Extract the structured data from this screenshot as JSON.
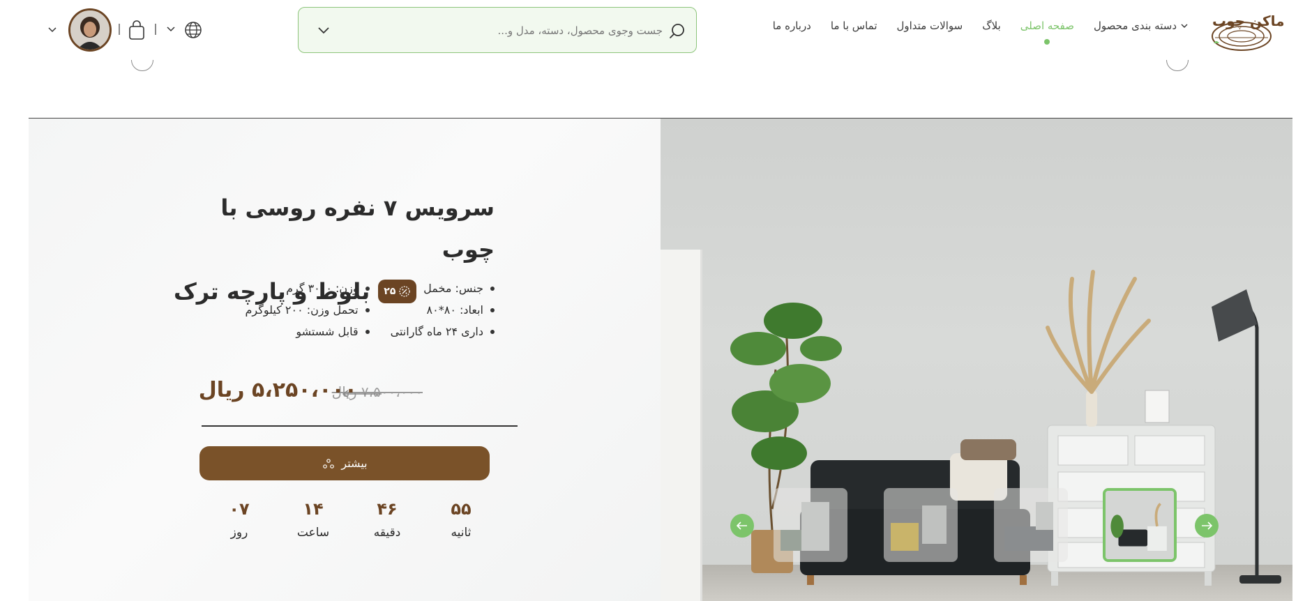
{
  "header": {
    "logo_text": "ماکن چوب",
    "nav": [
      {
        "label": "دسته بندی محصول",
        "has_dropdown": true,
        "active": false
      },
      {
        "label": "صفحه اصلی",
        "has_dropdown": false,
        "active": true
      },
      {
        "label": "بلاگ",
        "has_dropdown": false,
        "active": false
      },
      {
        "label": "سوالات متداول",
        "has_dropdown": false,
        "active": false
      },
      {
        "label": "تماس با ما",
        "has_dropdown": false,
        "active": false
      },
      {
        "label": "درباره ما",
        "has_dropdown": false,
        "active": false
      }
    ],
    "search": {
      "placeholder": "جست وجوی محصول، دسته، مدل و..."
    },
    "icons": {
      "search": "search-icon",
      "language": "globe-icon",
      "cart": "shopping-bag-icon",
      "user": "avatar"
    }
  },
  "product": {
    "title_line1": "سرویس ۷ نفره روسی با چوب",
    "title_line2": "بلوط و پارچه ترک",
    "discount_badge": "۲۵",
    "specs": [
      "جنس: مخمل",
      "وزن: ۳۰۰۰ گرم",
      "ابعاد: ۸۰*۸۰",
      "تحمل وزن: ۲۰۰ کیلوگرم",
      "داری ۲۴ ماه گارانتی",
      "قابل شستشو"
    ],
    "old_price": "۷،۵۰۰،۰۰۰ ریال",
    "new_price": "۵،۲۵۰،۰۰۰ ریال",
    "more_button": "بیشتر"
  },
  "countdown": [
    {
      "value": "۵۵",
      "label": "ثانیه"
    },
    {
      "value": "۴۶",
      "label": "دقیقه"
    },
    {
      "value": "۱۴",
      "label": "ساعت"
    },
    {
      "value": "۰۷",
      "label": "روز"
    }
  ],
  "gallery": {
    "thumbnail_count": 4,
    "active_index": 3
  },
  "colors": {
    "brand_brown": "#6b4423",
    "accent_green": "#7cc46a",
    "button_brown": "#7a5229"
  }
}
